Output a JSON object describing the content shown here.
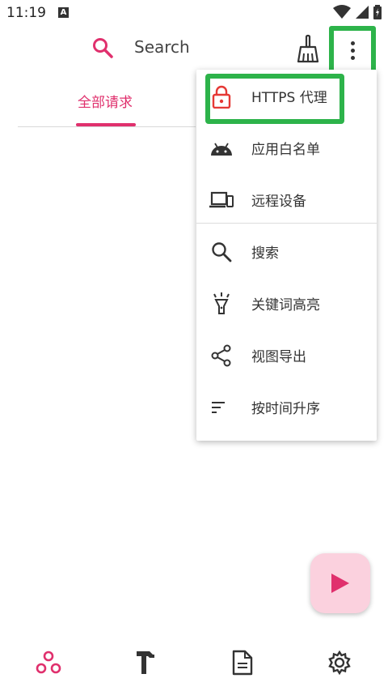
{
  "status": {
    "time": "11:19",
    "badge": "A"
  },
  "toolbar": {
    "search_label": "Search"
  },
  "tabs": [
    {
      "label": "全部请求"
    }
  ],
  "menu": {
    "items": [
      {
        "label": "HTTPS 代理",
        "icon": "lock-icon"
      },
      {
        "label": "应用白名单",
        "icon": "android-icon"
      },
      {
        "label": "远程设备",
        "icon": "devices-icon"
      },
      {
        "label": "搜索",
        "icon": "search-icon"
      },
      {
        "label": "关键词高亮",
        "icon": "highlight-icon"
      },
      {
        "label": "视图导出",
        "icon": "share-icon"
      },
      {
        "label": "按时间升序",
        "icon": "sort-icon"
      }
    ]
  },
  "bottom_nav": [
    {
      "icon": "capture-icon"
    },
    {
      "icon": "tools-icon"
    },
    {
      "icon": "document-icon"
    },
    {
      "icon": "settings-icon"
    }
  ],
  "colors": {
    "accent": "#e0306d",
    "highlight": "#2db34a",
    "fab_bg": "#fbd1de"
  }
}
